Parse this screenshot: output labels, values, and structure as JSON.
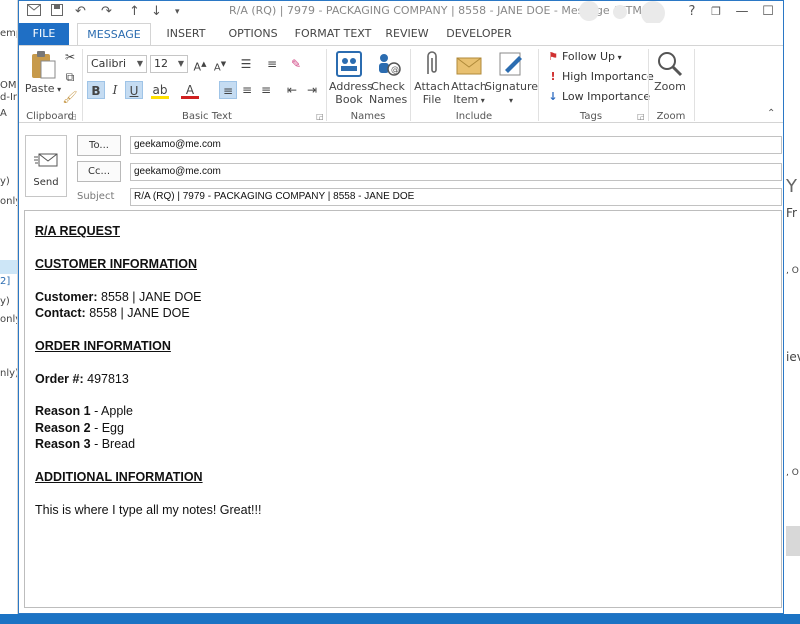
{
  "window": {
    "title": "R/A (RQ) | 7979 - PACKAGING COMPANY | 8558 - JANE DOE - Message (HTML)",
    "help": "?",
    "restore": "❐",
    "minimize": "—",
    "maximize": "☐"
  },
  "tabs": [
    {
      "label": "FILE"
    },
    {
      "label": "MESSAGE"
    },
    {
      "label": "INSERT"
    },
    {
      "label": "OPTIONS"
    },
    {
      "label": "FORMAT TEXT"
    },
    {
      "label": "REVIEW"
    },
    {
      "label": "DEVELOPER"
    }
  ],
  "ribbon": {
    "clipboard": {
      "paste": "Paste",
      "label": "Clipboard"
    },
    "basic_text": {
      "font": "Calibri",
      "size": "12",
      "label": "Basic Text"
    },
    "names": {
      "address_book": "Address Book",
      "check_names": "Check Names",
      "label": "Names"
    },
    "include": {
      "attach_file": "Attach File",
      "attach_item": "Attach Item",
      "signature": "Signature",
      "label": "Include"
    },
    "tags": {
      "follow_up": "Follow Up",
      "high_importance": "High Importance",
      "low_importance": "Low Importance",
      "label": "Tags"
    },
    "zoom": {
      "zoom": "Zoom",
      "label": "Zoom"
    }
  },
  "header": {
    "send": "Send",
    "to_button": "To...",
    "cc_button": "Cc...",
    "subject_label": "Subject",
    "to_value": "geekamo@me.com",
    "cc_value": "geekamo@me.com",
    "subject_value": "R/A (RQ) | 7979 - PACKAGING COMPANY | 8558 - JANE DOE"
  },
  "body": {
    "heading": "R/A REQUEST",
    "customer_section": "CUSTOMER INFORMATION",
    "customer_label": "Customer:",
    "customer_value": "8558 | JANE DOE",
    "contact_label": "Contact:",
    "contact_value": "8558 | JANE DOE",
    "order_section": "ORDER INFORMATION",
    "order_label": "Order #:",
    "order_value": "497813",
    "reasons": [
      {
        "label": "Reason 1",
        "value": "- Apple"
      },
      {
        "label": "Reason 2",
        "value": "- Egg"
      },
      {
        "label": "Reason 3",
        "value": "- Bread"
      }
    ],
    "additional_section": "ADDITIONAL INFORMATION",
    "notes": "This is where I type all my notes! Great!!!"
  },
  "background": {
    "left_fragments": [
      "emp",
      "OM",
      "d-In",
      "A",
      "y)",
      "only",
      "2]",
      "y)",
      "only",
      "nly)"
    ],
    "right_fragments": [
      "Y",
      "Fr",
      ", O",
      "iev",
      ", O"
    ]
  },
  "colors": {
    "accent": "#1f6fc5",
    "selected_format": "#c5dcf2",
    "high_importance": "#d03030",
    "low_importance": "#2e6cc0"
  }
}
